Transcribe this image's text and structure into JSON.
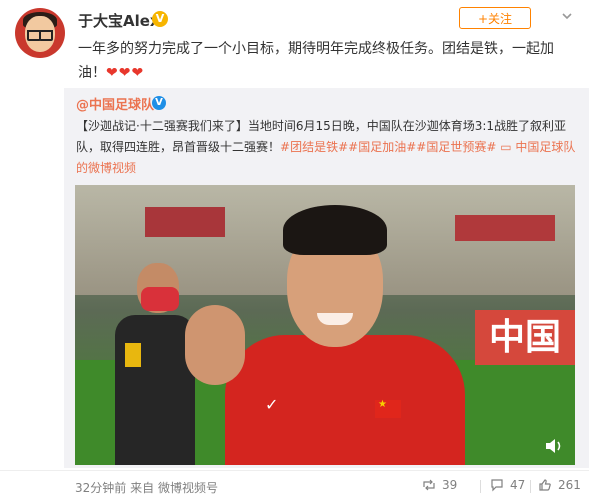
{
  "header": {
    "username": "于大宝Alex",
    "verified_badge": "V",
    "follow_label": "+关注",
    "chevron_icon": "chevron-down-icon"
  },
  "post": {
    "text": "一年多的努力完成了一个小目标，期待明年完成终极任务。团结是铁，一起加油！",
    "hearts": "❤❤❤"
  },
  "repost": {
    "author": "@中国足球队",
    "verified_badge": "V",
    "title": "【沙迦战记·十二强赛我们来了】",
    "body": "当地时间6月15日晚，中国队在沙迦体育场3:1战胜了叙利亚队，取得四连胜，昂首晋级十二强赛！",
    "tags": [
      "#团结是铁#",
      "#国足加油#",
      "#国足世预赛#"
    ],
    "video_link": "中国足球队的微博视频",
    "video": {
      "board_text": "中国",
      "volume_icon": "volume-icon"
    }
  },
  "footer": {
    "time": "32分钟前",
    "source_prefix": "来自",
    "source": "微博视频号",
    "repost_count": "39",
    "comment_count": "47",
    "like_count": "261"
  },
  "colors": {
    "accent": "#ff8200",
    "link": "#eb7350",
    "verified_gold": "#f7b500",
    "verified_blue": "#1f8fe6",
    "heart": "#e8372c"
  }
}
